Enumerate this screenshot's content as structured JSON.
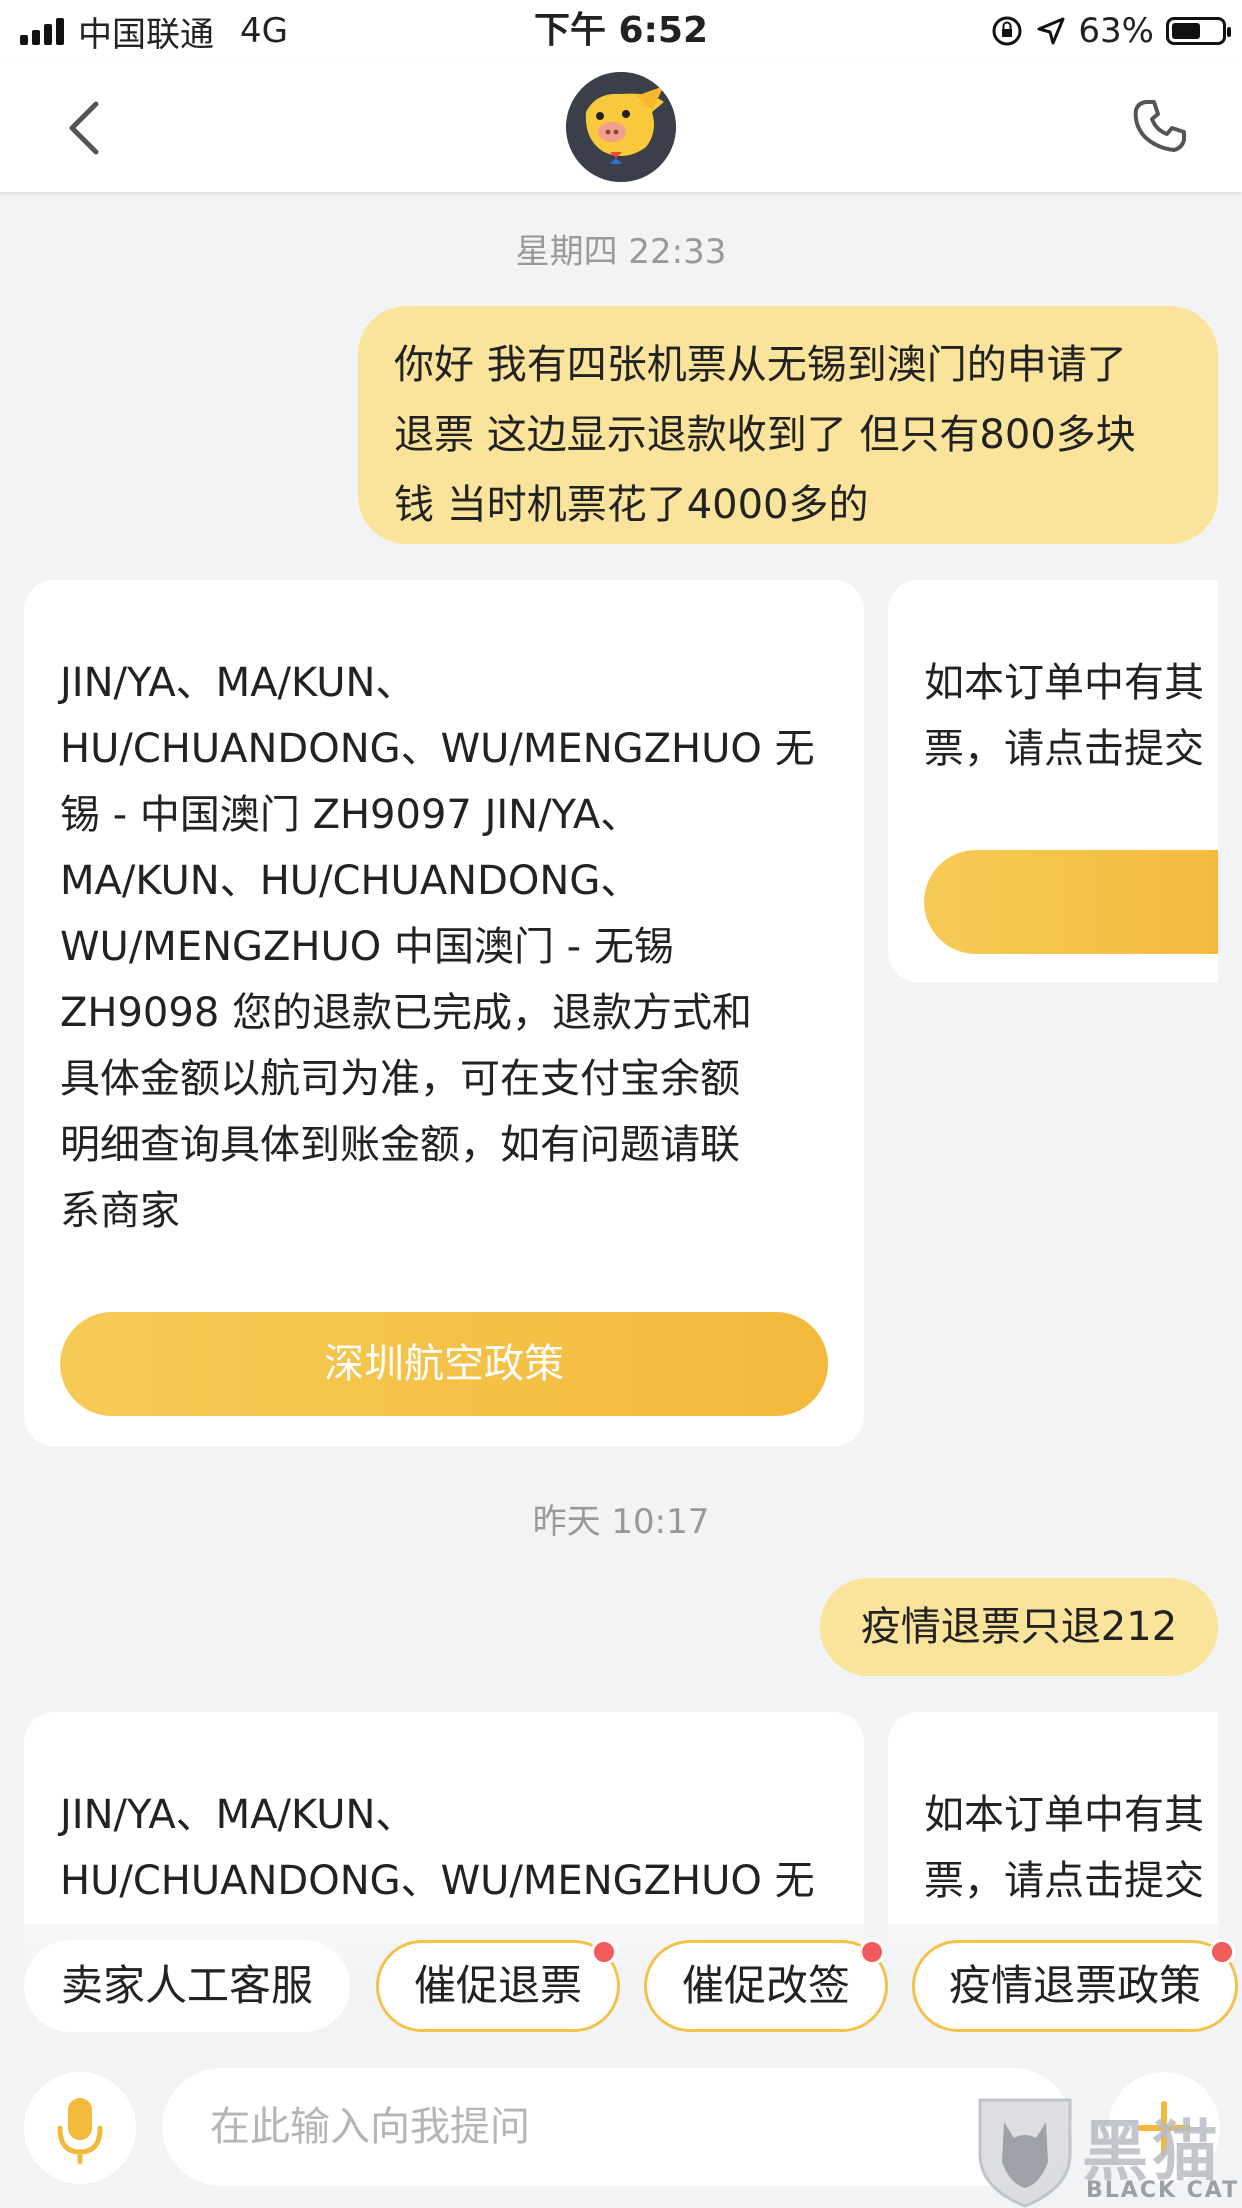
{
  "status_bar": {
    "carrier": "中国联通",
    "network": "4G",
    "time": "下午 6:52",
    "battery": "63%"
  },
  "nav": {
    "back_icon": "chevron-left-icon",
    "avatar_icon": "pig-mascot-avatar",
    "phone_icon": "phone-icon"
  },
  "messages": {
    "time1": "星期四 22:33",
    "user_msg1": {
      "line1": "你好 我有四张机票从无锡到澳门的申请了",
      "line2": "退票 这边显示退款收到了 但只有800多块",
      "line3": "钱 当时机票花了4000多的"
    },
    "card1": {
      "lines": [
        "JIN/YA、MA/KUN、",
        "HU/CHUANDONG、WU/MENGZHUO 无",
        "锡 - 中国澳门 ZH9097 JIN/YA、",
        "MA/KUN、HU/CHUANDONG、",
        "WU/MENGZHUO 中国澳门 - 无锡",
        "ZH9098 您的退款已完成，退款方式和",
        "具体金额以航司为准，可在支付宝余额",
        "明细查询具体到账金额，如有问题请联",
        "系商家"
      ],
      "button": "深圳航空政策"
    },
    "side_card1": {
      "line1": "如本订单中有其",
      "line2": "票，请点击提交"
    },
    "time2": "昨天 10:17",
    "user_msg2": "疫情退票只退212",
    "card2": {
      "line1": "JIN/YA、MA/KUN、",
      "line2": "HU/CHUANDONG、WU/MENGZHUO 无"
    },
    "side_card2": {
      "line1": "如本订单中有其",
      "line2": "票，请点击提交"
    }
  },
  "quick_actions": [
    {
      "label": "卖家人工客服",
      "badge": false
    },
    {
      "label": "催促退票",
      "badge": true
    },
    {
      "label": "催促改签",
      "badge": true
    },
    {
      "label": "疫情退票政策",
      "badge": true
    }
  ],
  "input": {
    "placeholder": "在此输入向我提问",
    "mic_icon": "microphone-icon",
    "plus_icon": "plus-icon"
  },
  "watermark": {
    "text_cn": "黑猫",
    "text_en": "BLACK CAT"
  },
  "colors": {
    "accent_yellow": "#f3c24b",
    "bubble_yellow": "#fae49b",
    "badge_red": "#f25b5b",
    "background": "#f2f3f5"
  }
}
